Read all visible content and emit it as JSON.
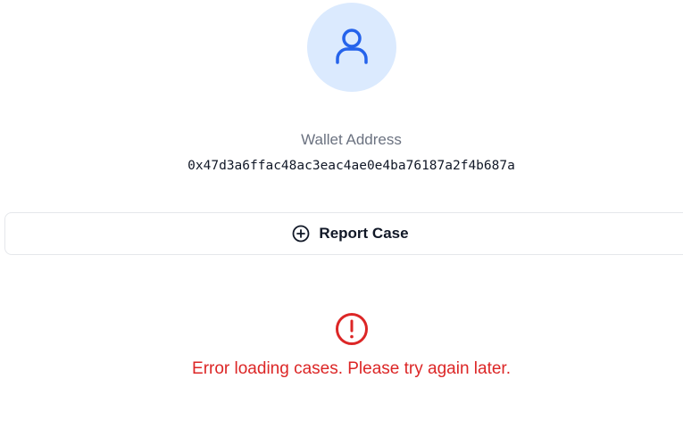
{
  "profile": {
    "avatar_icon": "user-icon",
    "wallet_label": "Wallet Address",
    "wallet_address": "0x47d3a6ffac48ac3eac4ae0e4ba76187a2f4b687a"
  },
  "actions": {
    "report_icon": "plus-circle-icon",
    "report_label": "Report Case"
  },
  "error": {
    "icon": "alert-circle-icon",
    "message": "Error loading cases. Please try again later."
  },
  "colors": {
    "avatar_bg": "#dbeafe",
    "accent_blue": "#2563eb",
    "error_red": "#dc2626",
    "muted_text": "#6b7280"
  }
}
